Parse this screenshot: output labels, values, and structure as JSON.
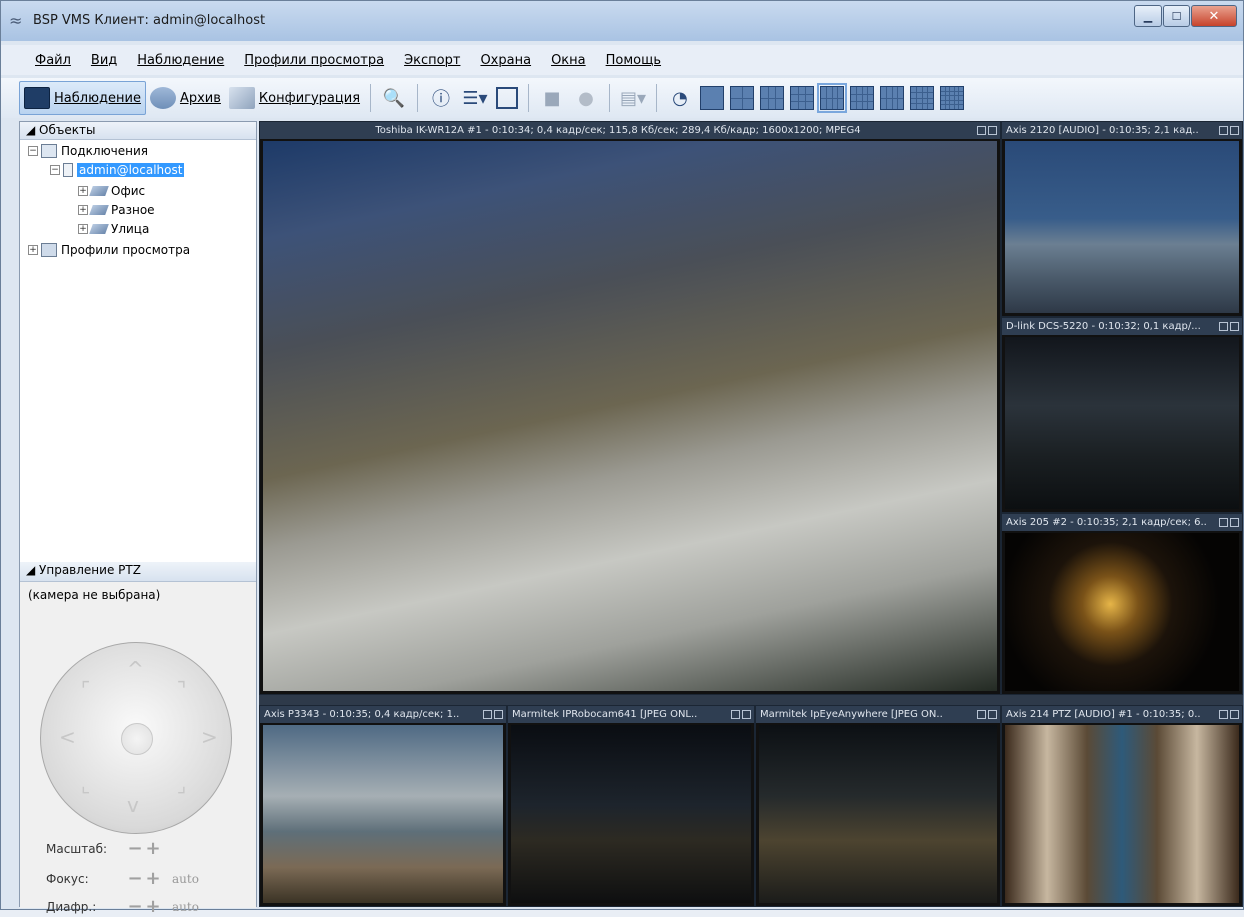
{
  "window": {
    "title": "BSP VMS Клиент: admin@localhost"
  },
  "menu": [
    "Файл",
    "Вид",
    "Наблюдение",
    "Профили просмотра",
    "Экспорт",
    "Охрана",
    "Окна",
    "Помощь"
  ],
  "toolbar": {
    "monitoring": "Наблюдение",
    "archive": "Архив",
    "config": "Конфигурация"
  },
  "objects_panel": {
    "title": "Объекты",
    "tree": {
      "connections": "Подключения",
      "server": "admin@localhost",
      "groups": [
        "Офис",
        "Разное",
        "Улица"
      ],
      "profiles": "Профили просмотра"
    }
  },
  "ptz": {
    "title": "Управление PTZ",
    "status": "(камера не выбрана)",
    "zoom": "Масштаб:",
    "focus": "Фокус:",
    "iris": "Диафр.:",
    "auto": "auto"
  },
  "cameras": [
    {
      "label": "Toshiba IK-WR12A #1 - 0:10:34; 0,4 кадр/сек; 115,8 Кб/сек; 289,4 Кб/кадр; 1600x1200; MPEG4"
    },
    {
      "label": "Axis 2120 [AUDIO] - 0:10:35; 2,1 кад.."
    },
    {
      "label": "D-link DCS-5220 - 0:10:32; 0,1 кадр/..."
    },
    {
      "label": "Axis 205 #2 - 0:10:35; 2,1 кадр/сек; 6.."
    },
    {
      "label": "Axis P3343 - 0:10:35; 0,4 кадр/сек; 1.."
    },
    {
      "label": "Marmitek IPRobocam641 [JPEG ONL.."
    },
    {
      "label": "Marmitek IpEyeAnywhere [JPEG ON.."
    },
    {
      "label": "Axis 214 PTZ [AUDIO] #1 - 0:10:35; 0.."
    }
  ]
}
